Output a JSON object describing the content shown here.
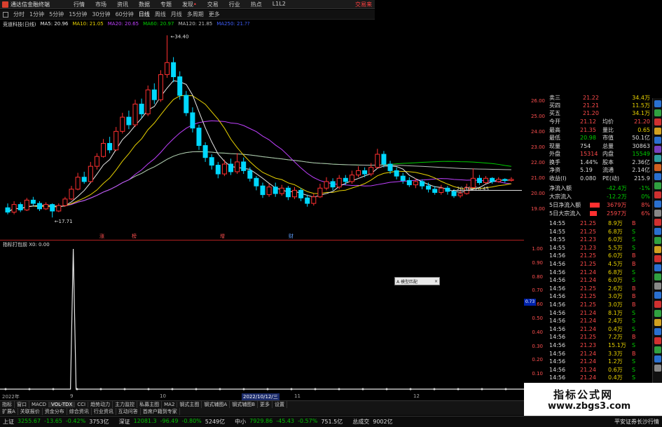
{
  "title_bar": {
    "app_title": "通达信金融终端",
    "menus": [
      "行情",
      "市场",
      "资讯",
      "数据",
      "专题",
      "发现",
      "交易",
      "行业",
      "热点",
      "L1L2"
    ],
    "right_link": "交易来"
  },
  "period_bar": {
    "periods": [
      "分时",
      "1分钟",
      "5分钟",
      "15分钟",
      "30分钟",
      "60分钟",
      "日线",
      "周线",
      "月线",
      "多周期",
      "更多"
    ],
    "selected": "日线"
  },
  "ma_legend": {
    "stock": "竞道科技(日线)",
    "items": [
      {
        "label": "MA5: 20.96",
        "color": "#e8e8e8"
      },
      {
        "label": "MA10: 21.05",
        "color": "#e8d200"
      },
      {
        "label": "MA20: 20.65",
        "color": "#c040ff"
      },
      {
        "label": "MA60: 20.97",
        "color": "#00d000"
      },
      {
        "label": "MA120: 21.85",
        "color": "#bbbbbb"
      },
      {
        "label": "MA250: 21.??",
        "color": "#4060ff"
      }
    ]
  },
  "chart_data": {
    "type": "candlestick",
    "annotations": {
      "high": "34.40",
      "low": "17.71",
      "recent": "20.45",
      "recent_low": "20.30"
    },
    "price_axis": [
      "26.00",
      "25.00",
      "24.00",
      "23.00",
      "22.00",
      "21.00",
      "20.00",
      "19.00"
    ],
    "markers": [
      "涨",
      "榜",
      "增",
      "财"
    ],
    "candles": [
      [
        18.6,
        18.2,
        19.0,
        18.0
      ],
      [
        18.2,
        18.9,
        19.2,
        18.0
      ],
      [
        18.9,
        18.4,
        19.1,
        18.2
      ],
      [
        18.4,
        19.3,
        19.5,
        18.3
      ],
      [
        19.3,
        19.0,
        19.6,
        18.8
      ],
      [
        19.0,
        18.5,
        19.2,
        18.3
      ],
      [
        18.5,
        18.9,
        19.1,
        18.4
      ],
      [
        18.9,
        18.3,
        19.0,
        17.71
      ],
      [
        18.3,
        18.8,
        19.0,
        18.2
      ],
      [
        18.8,
        19.4,
        19.6,
        18.7
      ],
      [
        19.4,
        20.3,
        20.6,
        19.3
      ],
      [
        20.3,
        21.4,
        21.8,
        20.2
      ],
      [
        21.4,
        21.0,
        21.9,
        20.8
      ],
      [
        21.0,
        22.4,
        22.8,
        20.9
      ],
      [
        22.4,
        23.3,
        23.6,
        22.1
      ],
      [
        23.3,
        24.5,
        24.9,
        23.2
      ],
      [
        24.5,
        23.9,
        25.1,
        23.6
      ],
      [
        23.9,
        25.6,
        26.0,
        23.8
      ],
      [
        25.6,
        26.9,
        27.3,
        25.4
      ],
      [
        26.9,
        26.2,
        27.5,
        25.8
      ],
      [
        26.2,
        28.1,
        28.5,
        26.0
      ],
      [
        28.1,
        27.2,
        28.6,
        26.8
      ],
      [
        27.2,
        29.4,
        29.8,
        27.0
      ],
      [
        29.4,
        28.5,
        30.0,
        28.1
      ],
      [
        28.5,
        30.8,
        31.2,
        28.3
      ],
      [
        30.8,
        31.9,
        34.4,
        30.5
      ],
      [
        31.9,
        30.6,
        32.4,
        30.1
      ],
      [
        30.6,
        28.9,
        31.1,
        28.5
      ],
      [
        28.9,
        27.3,
        29.3,
        27.0
      ],
      [
        27.3,
        25.9,
        27.8,
        25.5
      ],
      [
        25.9,
        24.3,
        26.2,
        23.9
      ],
      [
        24.3,
        23.2,
        24.6,
        22.8
      ],
      [
        23.2,
        22.5,
        23.5,
        22.1
      ],
      [
        22.5,
        21.7,
        22.8,
        21.3
      ],
      [
        21.7,
        22.6,
        23.0,
        21.5
      ],
      [
        22.6,
        21.9,
        23.1,
        21.6
      ],
      [
        21.9,
        22.8,
        23.6,
        21.7
      ],
      [
        22.8,
        22.0,
        23.2,
        21.7
      ],
      [
        22.0,
        21.3,
        22.3,
        21.0
      ],
      [
        21.3,
        20.6,
        21.5,
        20.2
      ],
      [
        20.6,
        19.8,
        20.9,
        19.5
      ],
      [
        19.8,
        20.5,
        20.8,
        19.6
      ],
      [
        20.5,
        19.9,
        20.9,
        19.6
      ],
      [
        19.9,
        20.4,
        20.7,
        19.7
      ],
      [
        20.4,
        19.6,
        20.6,
        19.3
      ],
      [
        19.6,
        20.2,
        20.5,
        19.4
      ],
      [
        20.2,
        19.5,
        20.4,
        19.2
      ],
      [
        19.5,
        19.0,
        19.8,
        18.7
      ],
      [
        19.0,
        19.6,
        19.9,
        18.8
      ],
      [
        19.6,
        20.4,
        20.8,
        19.5
      ],
      [
        20.4,
        21.0,
        21.4,
        20.2
      ],
      [
        21.0,
        20.5,
        21.3,
        20.2
      ],
      [
        20.5,
        21.3,
        21.6,
        20.3
      ],
      [
        21.3,
        21.0,
        21.6,
        20.7
      ],
      [
        21.0,
        21.6,
        22.0,
        20.8
      ],
      [
        21.6,
        22.0,
        22.4,
        21.4
      ],
      [
        22.0,
        21.7,
        22.3,
        21.4
      ],
      [
        21.7,
        22.3,
        22.7,
        21.5
      ],
      [
        22.3,
        23.5,
        24.0,
        22.2
      ],
      [
        23.5,
        22.6,
        23.8,
        22.3
      ],
      [
        22.6,
        22.0,
        22.9,
        21.7
      ],
      [
        22.0,
        21.5,
        22.3,
        21.2
      ],
      [
        21.5,
        21.1,
        21.8,
        20.8
      ],
      [
        21.1,
        20.7,
        21.4,
        20.5
      ],
      [
        20.7,
        21.0,
        21.3,
        20.4
      ],
      [
        21.0,
        20.6,
        21.2,
        20.3
      ],
      [
        20.6,
        20.3,
        20.9,
        20.0
      ],
      [
        20.3,
        20.0,
        20.6,
        19.8
      ],
      [
        20.0,
        20.4,
        20.7,
        19.8
      ],
      [
        20.4,
        20.1,
        20.6,
        19.8
      ],
      [
        20.1,
        19.7,
        20.3,
        19.5
      ],
      [
        19.7,
        19.9,
        20.2,
        19.5
      ],
      [
        19.9,
        20.45,
        20.8,
        19.8
      ],
      [
        20.45,
        21.3,
        22.2,
        20.4
      ],
      [
        21.3,
        20.9,
        21.6,
        20.7
      ],
      [
        20.9,
        21.3,
        21.5,
        20.8
      ],
      [
        21.3,
        21.0,
        21.4,
        20.8
      ],
      [
        21.0,
        21.2,
        21.4,
        20.9
      ],
      [
        21.2,
        21.1,
        21.3,
        20.9
      ],
      [
        21.1,
        21.2,
        21.4,
        21.0
      ]
    ]
  },
  "sub_chart": {
    "label": "指标打包前  X0: 0.00",
    "axis": [
      "1.00",
      "0.90",
      "0.80",
      "0.70",
      "0.60",
      "0.50",
      "0.40",
      "0.30",
      "0.20",
      "0.10",
      "0.00"
    ],
    "spike_index": 18
  },
  "popup": {
    "label": "A 模型匹配",
    "close": "×"
  },
  "cursor_tag": "0.73",
  "date_bar": {
    "start": "2022年",
    "cursor": "2022/10/12/三",
    "ticks": [
      "9",
      "10",
      "11",
      "12"
    ]
  },
  "tabs_row1": [
    "指标",
    "窗口",
    "MACD",
    "VOL-TDX",
    "CCI",
    "趋势动力",
    "主力监控",
    "私募主图",
    "MA2",
    "钢式主图",
    "钢式辅图A",
    "钢式辅图B",
    "更多",
    "设置"
  ],
  "tabs_row1_selected": "VOL-TDX",
  "tabs_row2": [
    "扩展A",
    "关联报价",
    "资金分布",
    "综合资讯",
    "行业资讯",
    "互动问答",
    "首席户籍到专家"
  ],
  "tabs_row2_right": "盘面F10",
  "quote_panel": {
    "top_rows": [
      {
        "label": "卖三",
        "price": "21.22",
        "vol": "34.4万"
      },
      {
        "label": "买四",
        "price": "21.21",
        "vol": "11.5万"
      },
      {
        "label": "买五",
        "price": "21.20",
        "vol": "34.1万"
      }
    ],
    "stats": [
      {
        "l1": "今开",
        "v1": "21.12",
        "l2": "均价",
        "v2": "21.20"
      },
      {
        "l1": "最高",
        "v1": "21.35",
        "l2": "量比",
        "v2": "0.65"
      },
      {
        "l1": "最低",
        "v1": "20.98",
        "l2": "市值",
        "v2": "50.1亿"
      },
      {
        "l1": "现量",
        "v1": "754",
        "l2": "总量",
        "v2": "30863"
      },
      {
        "l1": "外盘",
        "v1": "15314",
        "l2": "内盘",
        "v2": "15549"
      },
      {
        "l1": "换手",
        "v1": "1.44%",
        "l2": "股本",
        "v2": "2.36亿"
      },
      {
        "l1": "净资",
        "v1": "5.19",
        "l2": "流通",
        "v2": "2.14亿"
      },
      {
        "l1": "收益(Ⅰ)",
        "v1": "0.080",
        "l2": "PE(动)",
        "v2": "215.9"
      }
    ],
    "flows": [
      {
        "label": "净流入额",
        "value": "-42.4万",
        "pct": "-1%",
        "bar": 0
      },
      {
        "label": "大宗流入",
        "value": "-12.2万",
        "pct": "0%",
        "bar": 0
      },
      {
        "label": "5日净流入额",
        "value": "3679万",
        "pct": "8%",
        "bar": 14
      },
      {
        "label": "5日大宗流入",
        "value": "2597万",
        "pct": "6%",
        "bar": 10
      }
    ],
    "ticks": [
      {
        "time": "14:55",
        "price": "21.25",
        "vol": "8.9万",
        "side": "B"
      },
      {
        "time": "14:55",
        "price": "21.25",
        "vol": "6.8万",
        "side": "S"
      },
      {
        "time": "14:55",
        "price": "21.23",
        "vol": "6.0万",
        "side": "S"
      },
      {
        "time": "14:55",
        "price": "21.23",
        "vol": "5.5万",
        "side": "S"
      },
      {
        "time": "14:56",
        "price": "21.25",
        "vol": "6.0万",
        "side": "B"
      },
      {
        "time": "14:56",
        "price": "21.25",
        "vol": "4.5万",
        "side": "B"
      },
      {
        "time": "14:56",
        "price": "21.24",
        "vol": "6.8万",
        "side": "S"
      },
      {
        "time": "14:56",
        "price": "21.24",
        "vol": "6.0万",
        "side": "S"
      },
      {
        "time": "14:56",
        "price": "21.25",
        "vol": "2.6万",
        "side": "B"
      },
      {
        "time": "14:56",
        "price": "21.25",
        "vol": "3.0万",
        "side": "B"
      },
      {
        "time": "14:56",
        "price": "21.25",
        "vol": "3.0万",
        "side": "B"
      },
      {
        "time": "14:56",
        "price": "21.24",
        "vol": "8.1万",
        "side": "S"
      },
      {
        "time": "14:56",
        "price": "21.24",
        "vol": "2.4万",
        "side": "S"
      },
      {
        "time": "14:56",
        "price": "21.24",
        "vol": "0.4万",
        "side": "S"
      },
      {
        "time": "14:56",
        "price": "21.25",
        "vol": "7.2万",
        "side": "B"
      },
      {
        "time": "14:56",
        "price": "21.23",
        "vol": "15.1万",
        "side": "S"
      },
      {
        "time": "14:56",
        "price": "21.24",
        "vol": "3.3万",
        "side": "B"
      },
      {
        "time": "14:56",
        "price": "21.24",
        "vol": "1.2万",
        "side": "S"
      },
      {
        "time": "14:56",
        "price": "21.24",
        "vol": "0.6万",
        "side": "S"
      },
      {
        "time": "14:56",
        "price": "21.24",
        "vol": "0.4万",
        "side": "S"
      }
    ]
  },
  "status_bar": {
    "indices": [
      {
        "name": "上证",
        "value": "3255.67",
        "change": "-13.65",
        "pct": "-0.42%",
        "amount": "3753亿"
      },
      {
        "name": "深证",
        "value": "12081.3",
        "change": "-96.49",
        "pct": "-0.80%",
        "amount": "5249亿"
      },
      {
        "name": "中小",
        "value": "7929.86",
        "change": "-45.43",
        "pct": "-0.57%",
        "amount": "751.5亿"
      }
    ],
    "total_label": "总成交",
    "total_value": "9002亿",
    "news": "平安证券长沙行情"
  },
  "watermark": {
    "title": "指标公式网",
    "url": "www.zbgs3.com"
  }
}
